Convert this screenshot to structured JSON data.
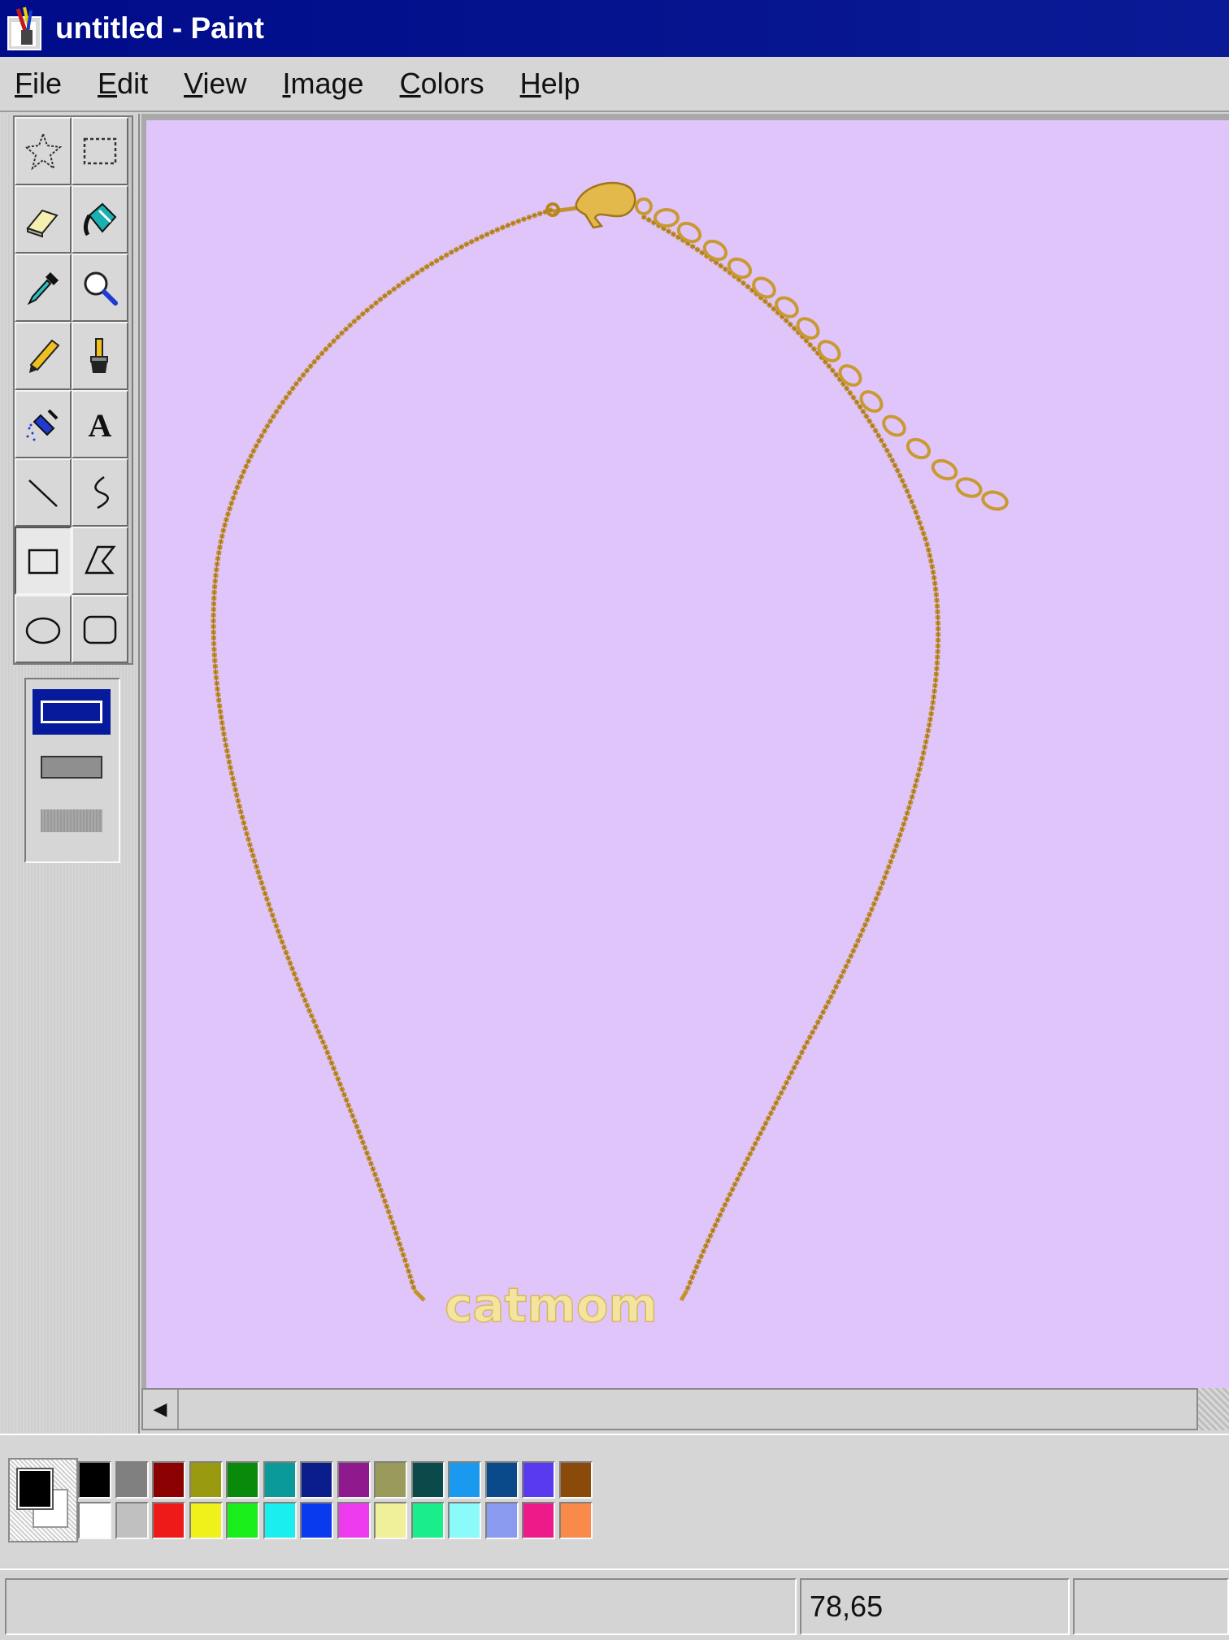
{
  "window": {
    "title": "untitled - Paint"
  },
  "menu": {
    "items": [
      {
        "key": "F",
        "rest": "ile"
      },
      {
        "key": "E",
        "rest": "dit"
      },
      {
        "key": "V",
        "rest": "iew"
      },
      {
        "key": "I",
        "rest": "mage"
      },
      {
        "key": "C",
        "rest": "olors"
      },
      {
        "key": "H",
        "rest": "elp"
      }
    ]
  },
  "tools": [
    "free-form-select-icon",
    "select-icon",
    "eraser-icon",
    "fill-with-color-icon",
    "pick-color-icon",
    "magnifier-icon",
    "pencil-icon",
    "brush-icon",
    "airbrush-icon",
    "text-icon",
    "line-icon",
    "curve-icon",
    "rectangle-icon",
    "polygon-icon",
    "ellipse-icon",
    "rounded-rectangle-icon"
  ],
  "active_tool": "rectangle-icon",
  "tool_options": [
    "outline-only",
    "outline-and-fill",
    "fill-only"
  ],
  "selected_option": "outline-only",
  "canvas": {
    "background": "#e0c5fb",
    "image_text": "catmom",
    "chain_color": "#c4922a",
    "pendant_color": "#f3e4a0"
  },
  "colors": {
    "foreground": "#000000",
    "background": "#ffffff",
    "palette_top": [
      "#000000",
      "#808080",
      "#8b0000",
      "#9a9a10",
      "#0a8a0a",
      "#0b9a9a",
      "#0b1d8a",
      "#8e1a8e",
      "#9a9a5a",
      "#0a4a4a",
      "#1a9aee",
      "#0a4a8a",
      "#5a3aee",
      "#8a4a0a"
    ],
    "palette_bottom": [
      "#ffffff",
      "#c0c0c0",
      "#ee1a1a",
      "#f0f01a",
      "#1aee1a",
      "#1aeeee",
      "#0a3aee",
      "#ee3aee",
      "#f0f09a",
      "#1aee8a",
      "#8afafa",
      "#8a9aee",
      "#ee1a8a",
      "#fa8a4a"
    ]
  },
  "status": {
    "message": "",
    "coordinates": "78,65",
    "size": ""
  }
}
